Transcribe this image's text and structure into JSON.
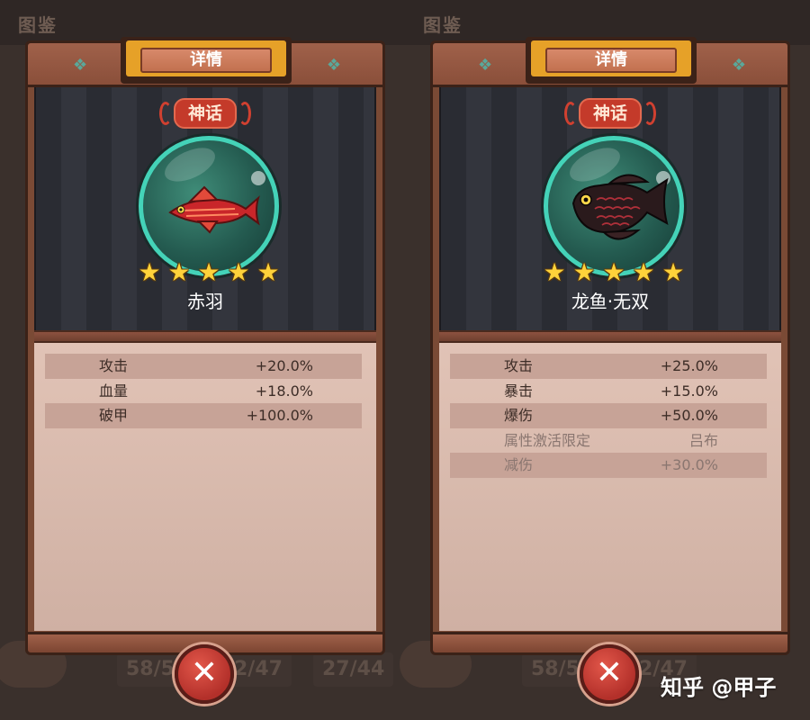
{
  "background": {
    "title": "图鉴",
    "counts_left": [
      "58/5",
      "2/47",
      "27/44"
    ],
    "counts_right": [
      "58/5",
      "2/47",
      "27/4"
    ]
  },
  "panels": [
    {
      "header": "详情",
      "rarity": "神话",
      "name": "赤羽",
      "stars": [
        "★",
        "★",
        "★",
        "★",
        "★"
      ],
      "fish_icon": "red-fish-icon",
      "stats": [
        {
          "label": "攻击",
          "value": "+20.0%"
        },
        {
          "label": "血量",
          "value": "+18.0%"
        },
        {
          "label": "破甲",
          "value": "+100.0%"
        }
      ],
      "close": "✕"
    },
    {
      "header": "详情",
      "rarity": "神话",
      "name": "龙鱼·无双",
      "stars": [
        "★",
        "★",
        "★",
        "★",
        "★"
      ],
      "fish_icon": "dark-arowana-icon",
      "stats": [
        {
          "label": "攻击",
          "value": "+25.0%"
        },
        {
          "label": "暴击",
          "value": "+15.0%"
        },
        {
          "label": "爆伤",
          "value": "+50.0%"
        },
        {
          "label": "属性激活限定",
          "value": "吕布"
        },
        {
          "label": "减伤",
          "value": "+30.0%"
        }
      ],
      "close": "✕"
    }
  ],
  "watermark": "知乎 @甲子",
  "colors": {
    "panel_wood": "#7a4a35",
    "tab_gold": "#e6a128",
    "rarity_red": "#c43a2a",
    "orb_teal": "#44d3b8",
    "star_gold": "#ffd23a",
    "stat_text": "#3d2d27",
    "close_red": "#b3302a"
  }
}
